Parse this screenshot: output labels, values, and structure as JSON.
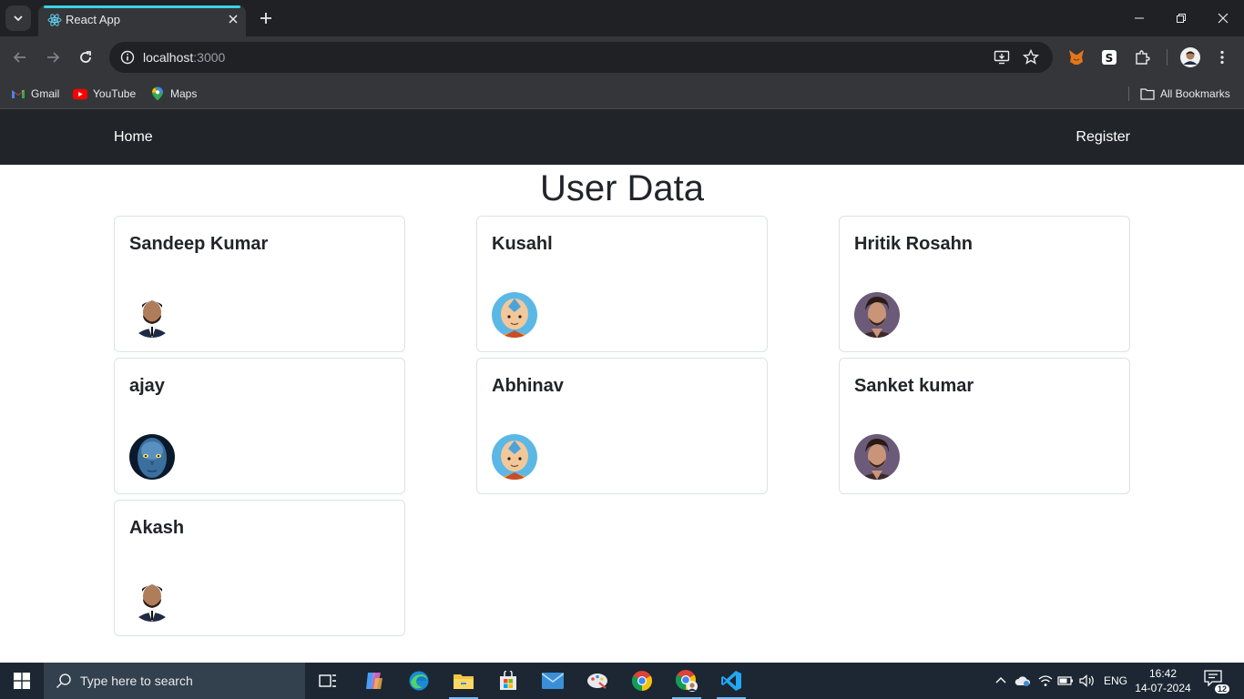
{
  "browser": {
    "tab_title": "React App",
    "url_host": "localhost",
    "url_port": ":3000",
    "bookmarks": [
      {
        "label": "Gmail",
        "icon": "gmail-icon"
      },
      {
        "label": "YouTube",
        "icon": "youtube-icon"
      },
      {
        "label": "Maps",
        "icon": "maps-icon"
      }
    ],
    "all_bookmarks_label": "All Bookmarks"
  },
  "navbar": {
    "home_label": "Home",
    "register_label": "Register"
  },
  "main": {
    "title": "User Data",
    "users": [
      {
        "name": "Sandeep Kumar",
        "avatar": "man-portrait-avatar"
      },
      {
        "name": "Kusahl",
        "avatar": "cartoon-monk-avatar"
      },
      {
        "name": "Hritik Rosahn",
        "avatar": "actor-portrait-avatar"
      },
      {
        "name": "ajay",
        "avatar": "blue-alien-avatar"
      },
      {
        "name": "Abhinav",
        "avatar": "cartoon-monk-avatar"
      },
      {
        "name": "Sanket kumar",
        "avatar": "actor-portrait-avatar"
      },
      {
        "name": "Akash",
        "avatar": "man-portrait-avatar"
      }
    ]
  },
  "taskbar": {
    "search_placeholder": "Type here to search",
    "language": "ENG",
    "time": "16:42",
    "date": "14-07-2024",
    "notification_count": "12"
  },
  "colors": {
    "navbar_bg": "#212529",
    "tab_accent": "#3ad3e4",
    "page_bg": "#ffffff"
  }
}
